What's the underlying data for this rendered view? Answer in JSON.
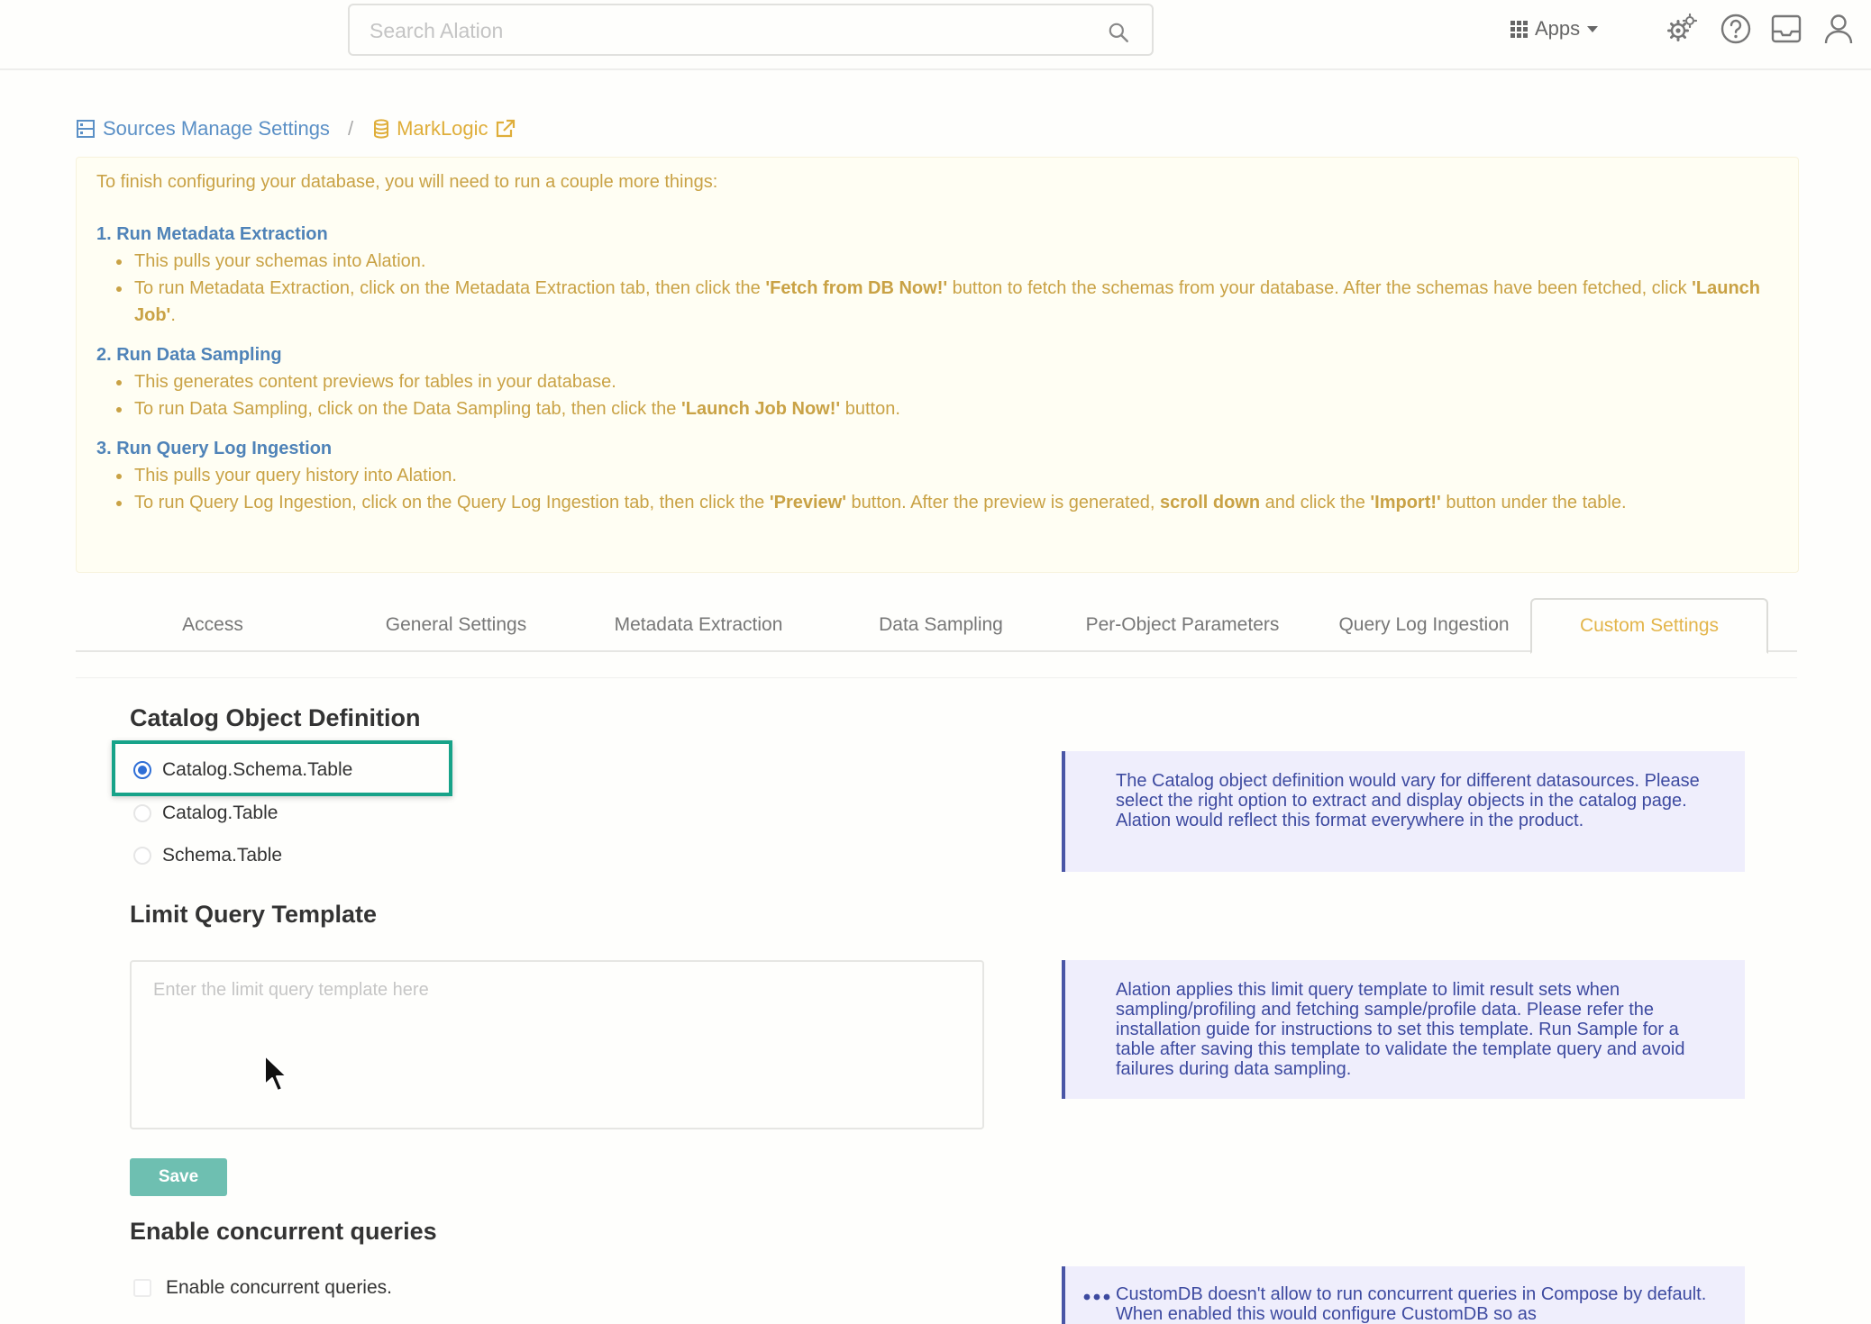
{
  "topbar": {
    "search_placeholder": "Search Alation",
    "apps_label": "Apps",
    "icons": [
      "search-icon",
      "gears-icon",
      "help-icon",
      "inbox-icon",
      "user-icon"
    ]
  },
  "breadcrumb": {
    "sources": "Sources Manage Settings",
    "separator": "/",
    "current": "MarkLogic"
  },
  "instructions": {
    "intro": "To finish configuring your database, you will need to run a couple more things:",
    "step1": {
      "title": "1. Run Metadata Extraction",
      "b1": "This pulls your schemas into Alation.",
      "b2_pre": "To run Metadata Extraction, click on the Metadata Extraction tab, then click the ",
      "b2_bold1": "'Fetch from DB Now!'",
      "b2_mid": " button to fetch the schemas from your database. After the schemas have been fetched, click ",
      "b2_bold2": "'Launch Job'",
      "b2_end": "."
    },
    "step2": {
      "title": "2. Run Data Sampling",
      "b1": "This generates content previews for tables in your database.",
      "b2_pre": "To run Data Sampling, click on the Data Sampling tab, then click the ",
      "b2_bold1": "'Launch Job Now!'",
      "b2_end": " button."
    },
    "step3": {
      "title": "3. Run Query Log Ingestion",
      "b1": "This pulls your query history into Alation.",
      "b2_pre": "To run Query Log Ingestion, click on the Query Log Ingestion tab, then click the ",
      "b2_bold1": "'Preview'",
      "b2_mid": " button. After the preview is generated, ",
      "b2_bold2": "scroll down",
      "b2_mid2": " and click the ",
      "b2_bold3": "'Import!'",
      "b2_end": " button under the table."
    }
  },
  "tabs": [
    {
      "label": "Access",
      "active": false
    },
    {
      "label": "General Settings",
      "active": false
    },
    {
      "label": "Metadata Extraction",
      "active": false
    },
    {
      "label": "Data Sampling",
      "active": false
    },
    {
      "label": "Per-Object Parameters",
      "active": false
    },
    {
      "label": "Query Log Ingestion",
      "active": false
    },
    {
      "label": "Custom Settings",
      "active": true
    }
  ],
  "catalog": {
    "title": "Catalog Object Definition",
    "options": [
      {
        "label": "Catalog.Schema.Table",
        "checked": true
      },
      {
        "label": "Catalog.Table",
        "checked": false
      },
      {
        "label": "Schema.Table",
        "checked": false
      }
    ],
    "info": "The Catalog object definition would vary for different datasources. Please select the right option to extract and display objects in the catalog page. Alation would reflect this format everywhere in the product."
  },
  "limit_query": {
    "title": "Limit Query Template",
    "placeholder": "Enter the limit query template here",
    "info": "Alation applies this limit query template to limit result sets when sampling/profiling and fetching sample/profile data. Please refer the installation guide for instructions to set this template. Run Sample for a table after saving this template to validate the template query and avoid failures during data sampling.",
    "save_label": "Save"
  },
  "concurrent": {
    "title": "Enable concurrent queries",
    "checkbox_label": "Enable concurrent queries.",
    "checked": false,
    "info": "CustomDB doesn't allow to run concurrent queries in Compose by default. When enabled this would configure CustomDB so as"
  },
  "colors": {
    "link_blue": "#5b90c6",
    "accent_gold": "#e3b54b",
    "highlight_green": "#17a389",
    "save_teal": "#6ebfb1",
    "info_bg": "#efeefc",
    "info_text": "#3d4aa0"
  }
}
